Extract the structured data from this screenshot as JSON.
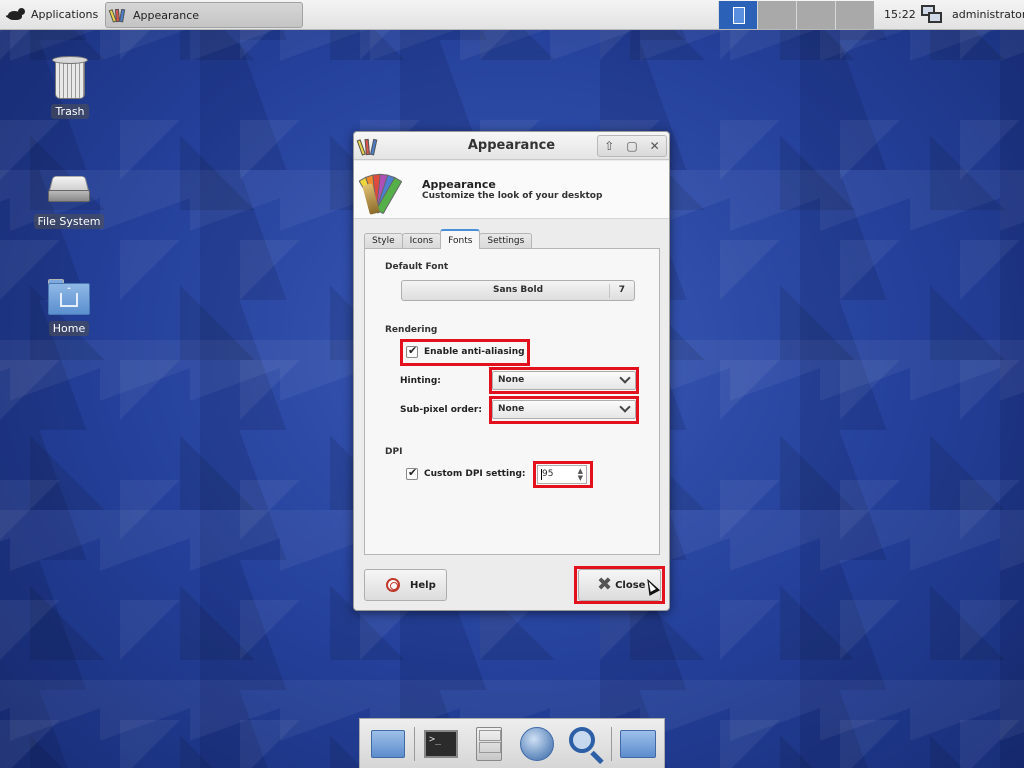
{
  "panel": {
    "apps_label": "Applications",
    "task_label": "Appearance",
    "clock": "15:22",
    "user": "administrator",
    "workspaces": 4,
    "active_workspace": 1
  },
  "desktop": {
    "icons": [
      {
        "label": "Trash",
        "icon": "trash-icon"
      },
      {
        "label": "File System",
        "icon": "drive-icon"
      },
      {
        "label": "Home",
        "icon": "home-folder-icon"
      }
    ]
  },
  "dialog": {
    "title": "Appearance",
    "header_title": "Appearance",
    "header_subtitle": "Customize the look of your desktop",
    "tabs": [
      {
        "label": "Style",
        "active": false
      },
      {
        "label": "Icons",
        "active": false
      },
      {
        "label": "Fonts",
        "active": true
      },
      {
        "label": "Settings",
        "active": false
      }
    ],
    "fonts": {
      "default_font_label": "Default Font",
      "font_name": "Sans Bold",
      "font_size": "7",
      "rendering_label": "Rendering",
      "antialias_label": "Enable anti-aliasing",
      "antialias_checked": true,
      "hinting_label": "Hinting:",
      "hinting_value": "None",
      "subpixel_label": "Sub-pixel order:",
      "subpixel_value": "None",
      "dpi_label": "DPI",
      "custom_dpi_label": "Custom DPI setting:",
      "custom_dpi_checked": true,
      "dpi_value": "95"
    },
    "help_label": "Help",
    "close_label": "Close"
  },
  "highlight_color": "#e3101e",
  "dock": {
    "items": [
      "desktop-icon",
      "terminal-icon",
      "file-cabinet-icon",
      "web-browser-icon",
      "search-icon",
      "folder-icon"
    ]
  }
}
